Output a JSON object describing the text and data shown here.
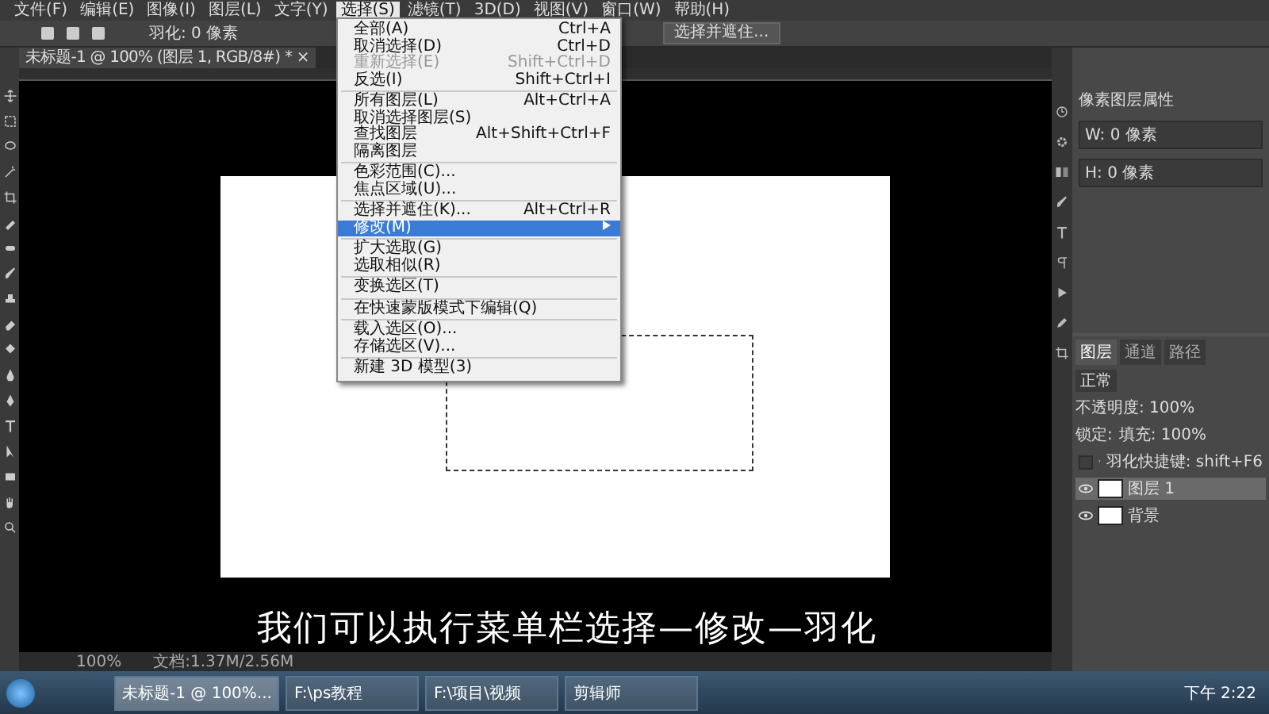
{
  "menu_bar": [
    {
      "label": "文件(F)",
      "selected": false
    },
    {
      "label": "编辑(E)",
      "selected": false
    },
    {
      "label": "图像(I)",
      "selected": false
    },
    {
      "label": "图层(L)",
      "selected": false
    },
    {
      "label": "文字(Y)",
      "selected": false
    },
    {
      "label": "选择(S)",
      "selected": true
    },
    {
      "label": "滤镜(T)",
      "selected": false
    },
    {
      "label": "3D(D)",
      "selected": false
    },
    {
      "label": "视图(V)",
      "selected": false
    },
    {
      "label": "窗口(W)",
      "selected": false
    },
    {
      "label": "帮助(H)",
      "selected": false
    }
  ],
  "options_bar": {
    "feather": "羽化: 0 像素",
    "select_mask_button": "选择并遮住..."
  },
  "document_tab": "未标题-1 @ 100% (图层 1, RGB/8#) * ×",
  "select_menu": [
    {
      "kind": "item",
      "label": "全部(A)",
      "shortcut": "Ctrl+A",
      "disabled": false,
      "selected": false
    },
    {
      "kind": "item",
      "label": "取消选择(D)",
      "shortcut": "Ctrl+D",
      "disabled": false,
      "selected": false
    },
    {
      "kind": "item",
      "label": "重新选择(E)",
      "shortcut": "Shift+Ctrl+D",
      "disabled": true,
      "selected": false
    },
    {
      "kind": "item",
      "label": "反选(I)",
      "shortcut": "Shift+Ctrl+I",
      "disabled": false,
      "selected": false
    },
    {
      "kind": "separator"
    },
    {
      "kind": "item",
      "label": "所有图层(L)",
      "shortcut": "Alt+Ctrl+A",
      "disabled": false,
      "selected": false
    },
    {
      "kind": "item",
      "label": "取消选择图层(S)",
      "disabled": false,
      "selected": false
    },
    {
      "kind": "item",
      "label": "查找图层",
      "shortcut": "Alt+Shift+Ctrl+F",
      "disabled": false,
      "selected": false
    },
    {
      "kind": "item",
      "label": "隔离图层",
      "disabled": false,
      "selected": false
    },
    {
      "kind": "separator"
    },
    {
      "kind": "item",
      "label": "色彩范围(C)...",
      "disabled": false,
      "selected": false
    },
    {
      "kind": "item",
      "label": "焦点区域(U)...",
      "disabled": false,
      "selected": false
    },
    {
      "kind": "separator"
    },
    {
      "kind": "item",
      "label": "选择并遮住(K)...",
      "shortcut": "Alt+Ctrl+R",
      "disabled": false,
      "selected": false
    },
    {
      "kind": "submenu",
      "label": "修改(M)",
      "disabled": false,
      "selected": true
    },
    {
      "kind": "separator"
    },
    {
      "kind": "item",
      "label": "扩大选取(G)",
      "disabled": false,
      "selected": false
    },
    {
      "kind": "item",
      "label": "选取相似(R)",
      "disabled": false,
      "selected": false
    },
    {
      "kind": "separator"
    },
    {
      "kind": "item",
      "label": "变换选区(T)",
      "disabled": false,
      "selected": false
    },
    {
      "kind": "separator"
    },
    {
      "kind": "item",
      "label": "在快速蒙版模式下编辑(Q)",
      "disabled": false,
      "selected": false
    },
    {
      "kind": "separator"
    },
    {
      "kind": "item",
      "label": "载入选区(O)...",
      "disabled": false,
      "selected": false
    },
    {
      "kind": "item",
      "label": "存储选区(V)...",
      "disabled": false,
      "selected": false
    },
    {
      "kind": "separator"
    },
    {
      "kind": "item",
      "label": "新建 3D 模型(3)",
      "disabled": false,
      "selected": false
    }
  ],
  "properties_panel": {
    "title": "像素图层属性",
    "w_field": "W: 0 像素",
    "h_field": "H: 0 像素"
  },
  "layers_panel": {
    "tabs": [
      {
        "label": "图层",
        "selected": true
      },
      {
        "label": "通道",
        "selected": false
      },
      {
        "label": "路径",
        "selected": false
      }
    ],
    "blend_mode": "正常",
    "opacity": "不透明度: 100%",
    "lock": "锁定:",
    "fill": "填充: 100%",
    "layers": [
      {
        "kind": "text",
        "name": "羽化快捷键: shift+F6",
        "selected": false,
        "visible": false
      },
      {
        "kind": "pixel",
        "name": "图层 1",
        "selected": true,
        "visible": true
      },
      {
        "kind": "background",
        "name": "背景",
        "selected": false,
        "visible": true
      }
    ]
  },
  "status_bar": {
    "zoom": "100%",
    "doc_size": "文档:1.37M/2.56M"
  },
  "subtitle": "我们可以执行菜单栏选择—修改—羽化",
  "taskbar": {
    "items": [
      {
        "label": "未标题-1 @ 100%...",
        "selected": true
      },
      {
        "label": "F:\\ps教程",
        "selected": false
      },
      {
        "label": "F:\\项目\\视频",
        "selected": false
      },
      {
        "label": "剪辑师",
        "selected": false
      }
    ],
    "clock": "下午 2:22"
  }
}
